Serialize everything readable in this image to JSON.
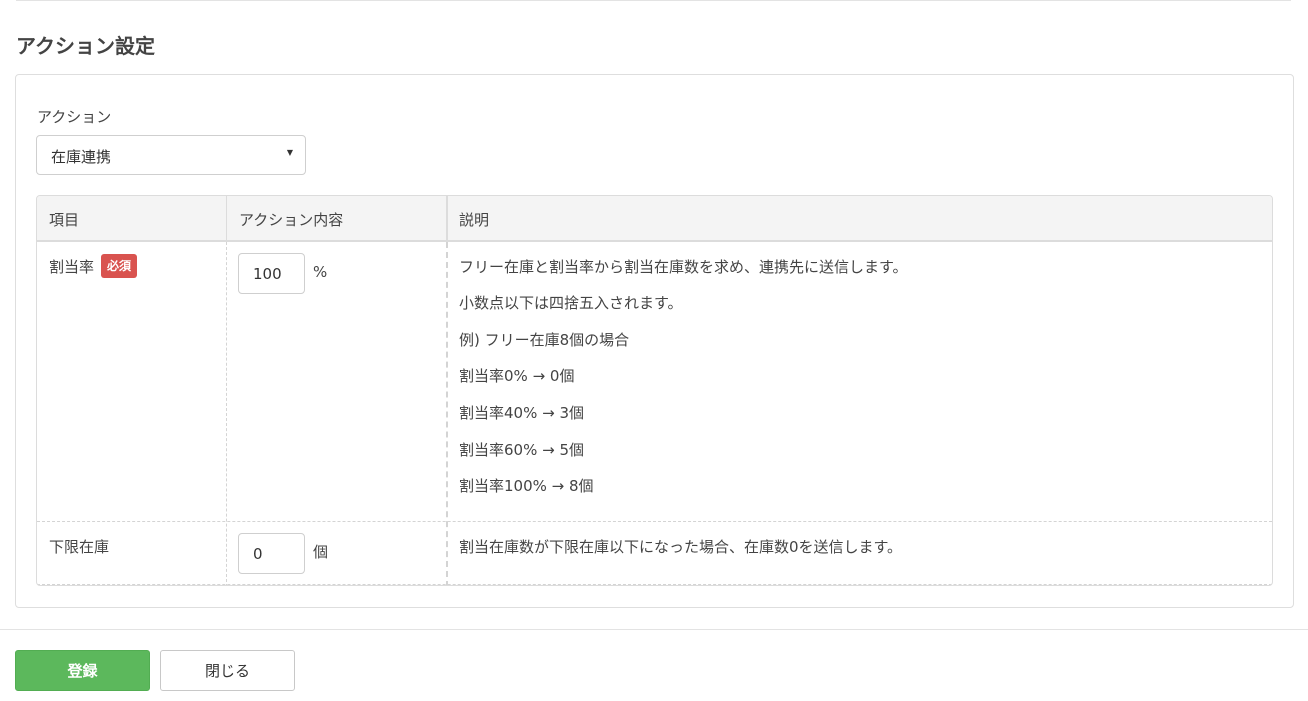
{
  "section": {
    "title": "アクション設定"
  },
  "action": {
    "label": "アクション",
    "selected": "在庫連携"
  },
  "table": {
    "headers": [
      "項目",
      "アクション内容",
      "説明"
    ],
    "rows": [
      {
        "item": "割当率",
        "required_badge": "必須",
        "input_value": "100",
        "unit": "%",
        "description": [
          "フリー在庫と割当率から割当在庫数を求め、連携先に送信します。",
          "小数点以下は四捨五入されます。",
          "例) フリー在庫8個の場合",
          "割当率0% → 0個",
          "割当率40% → 3個",
          "割当率60% → 5個",
          "割当率100% → 8個"
        ]
      },
      {
        "item": "下限在庫",
        "input_value": "0",
        "unit": "個",
        "description": [
          "割当在庫数が下限在庫以下になった場合、在庫数0を送信します。"
        ]
      }
    ]
  },
  "buttons": {
    "submit": "登録",
    "close": "閉じる"
  },
  "colors": {
    "primary": "#5cb85c",
    "danger": "#d9534f",
    "header_bg": "#f4f4f4"
  }
}
